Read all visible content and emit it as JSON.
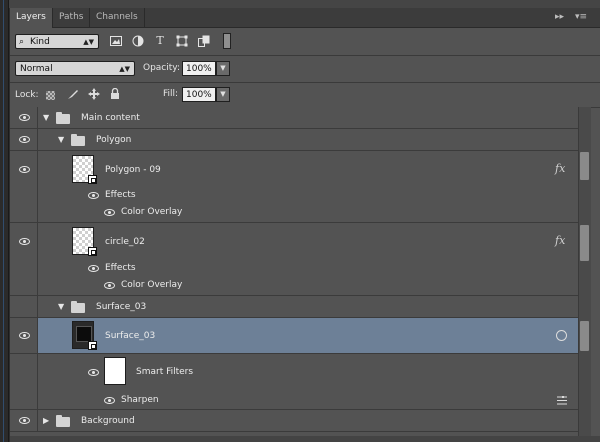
{
  "tabs": [
    {
      "label": "Layers",
      "active": true
    },
    {
      "label": "Paths",
      "active": false
    },
    {
      "label": "Channels",
      "active": false
    }
  ],
  "panel_controls": {
    "collapse": "▸▸",
    "menu": "▾≡"
  },
  "filter": {
    "kind_label": "Kind",
    "icons": [
      "pixel-filter-icon",
      "adjustment-filter-icon",
      "type-filter-icon",
      "shape-filter-icon",
      "smart-object-filter-icon",
      "filter-toggle-icon"
    ],
    "type_glyph": "T"
  },
  "blend": {
    "mode": "Normal",
    "opacity_label": "Opacity:",
    "opacity_value": "100%"
  },
  "lock": {
    "label": "Lock:",
    "fill_label": "Fill:",
    "fill_value": "100%"
  },
  "layers": {
    "main_content": "Main content",
    "polygon_group": "Polygon",
    "polygon_09": "Polygon - 09",
    "polygon_09_effects": "Effects",
    "polygon_09_overlay": "Color Overlay",
    "circle_02": "circle_02",
    "circle_02_effects": "Effects",
    "circle_02_overlay": "Color Overlay",
    "surface_group": "Surface_03",
    "surface_layer": "Surface_03",
    "smart_filters": "Smart Filters",
    "sharpen": "Sharpen",
    "background": "Background",
    "fx_glyph": "fx"
  },
  "colors": {
    "panel": "#535353",
    "selected_row": "#6d8097",
    "tabbar": "#3c3c3c"
  }
}
